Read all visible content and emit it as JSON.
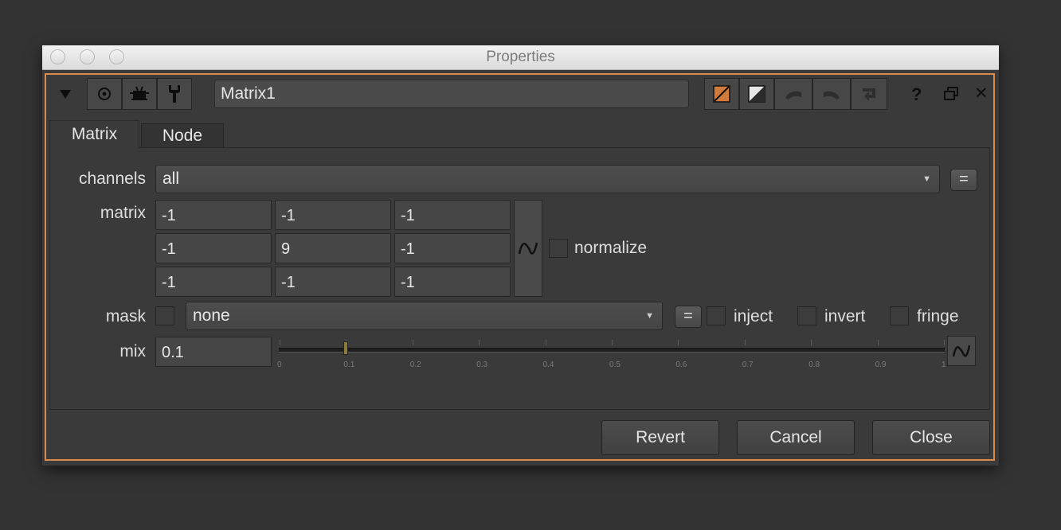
{
  "window": {
    "title": "Properties"
  },
  "toolbar": {
    "node_name": "Matrix1",
    "icons": [
      "collapse-triangle-icon",
      "viewer-icon",
      "bug-icon",
      "wrench-icon",
      "orange-color-swatch-icon",
      "gray-color-swatch-icon",
      "undo-icon",
      "redo-icon",
      "revert-icon",
      "help-icon",
      "float-panel-icon",
      "close-icon"
    ],
    "help_label": "?",
    "close_label": "✕"
  },
  "tabs": [
    {
      "label": "Matrix",
      "active": true
    },
    {
      "label": "Node",
      "active": false
    }
  ],
  "channels": {
    "label": "channels",
    "value": "all",
    "eq_label": "="
  },
  "matrix": {
    "label": "matrix",
    "rows": [
      [
        "-1",
        "-1",
        "-1"
      ],
      [
        "-1",
        "9",
        "-1"
      ],
      [
        "-1",
        "-1",
        "-1"
      ]
    ],
    "normalize_label": "normalize",
    "normalize_checked": false
  },
  "mask": {
    "label": "mask",
    "enabled": false,
    "value": "none",
    "eq_label": "=",
    "inject_label": "inject",
    "invert_label": "invert",
    "fringe_label": "fringe"
  },
  "mix": {
    "label": "mix",
    "value": "0.1",
    "slider_value": 0.1,
    "slider_range": [
      0,
      1
    ],
    "ticks": [
      "0",
      "0.1",
      "0.2",
      "0.3",
      "0.4",
      "0.5",
      "0.6",
      "0.7",
      "0.8",
      "0.9",
      "1"
    ]
  },
  "buttons": {
    "revert": "Revert",
    "cancel": "Cancel",
    "close": "Close"
  },
  "colors": {
    "panel_border": "#d98a4a",
    "swatch_orange": "#d07a3c",
    "slider_handle": "#8a7a3c"
  }
}
